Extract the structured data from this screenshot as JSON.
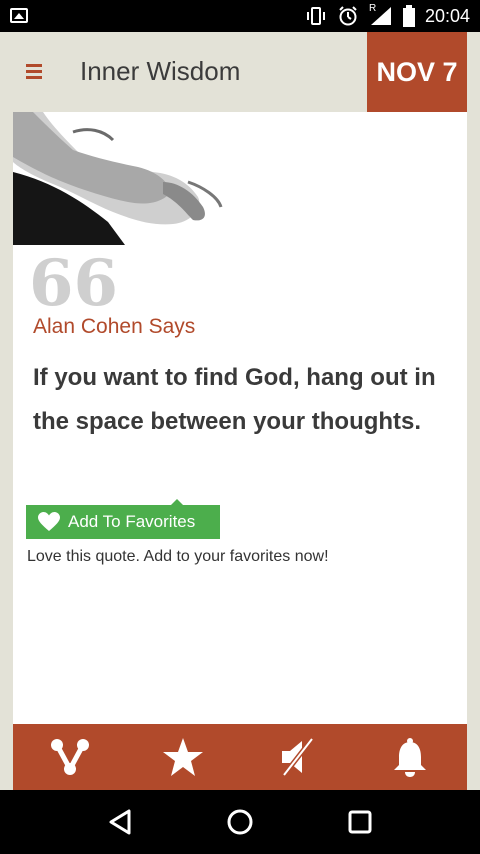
{
  "status_bar": {
    "time": "20:04",
    "icons": [
      "image-notification-icon",
      "vibrate-icon",
      "alarm-icon",
      "signal-roaming-icon",
      "battery-icon"
    ],
    "roaming_label": "R"
  },
  "app_bar": {
    "title": "Inner Wisdom",
    "date": "NOV 7",
    "accent_color": "#b14a2b"
  },
  "quote": {
    "author_line": "Alan Cohen Says",
    "text": "If you want to find God, hang out in the space between your thoughts.",
    "quote_mark": "66"
  },
  "favorites": {
    "button_label": "Add To Favorites",
    "hint": "Love this quote. Add to your favorites now!",
    "button_color": "#4cae4c"
  },
  "toolbar": {
    "items": [
      "share-icon",
      "star-icon",
      "sound-muted-icon",
      "bell-icon"
    ]
  },
  "nav_bar": {
    "items": [
      "back-icon",
      "home-icon",
      "recents-icon"
    ]
  }
}
